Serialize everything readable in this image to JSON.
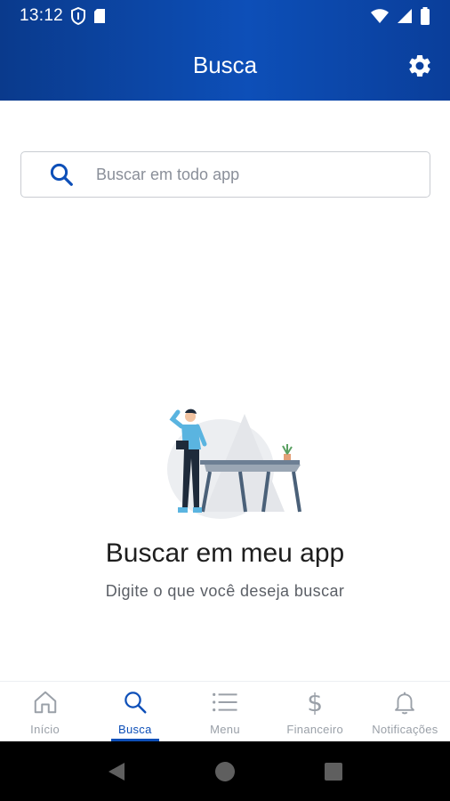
{
  "status": {
    "time": "13:12"
  },
  "header": {
    "title": "Busca"
  },
  "search": {
    "placeholder": "Buscar em todo app",
    "value": ""
  },
  "empty_state": {
    "title": "Buscar em meu app",
    "subtitle": "Digite o que você deseja buscar"
  },
  "bottom_nav": {
    "items": [
      {
        "label": "Início",
        "icon": "home-icon"
      },
      {
        "label": "Busca",
        "icon": "search-icon",
        "active": true
      },
      {
        "label": "Menu",
        "icon": "menu-icon"
      },
      {
        "label": "Financeiro",
        "icon": "dollar-icon"
      },
      {
        "label": "Notificações",
        "icon": "bell-icon"
      }
    ]
  },
  "colors": {
    "primary": "#0d4fb8",
    "header_dark": "#0a3a8c",
    "inactive": "#9aa0a8"
  }
}
